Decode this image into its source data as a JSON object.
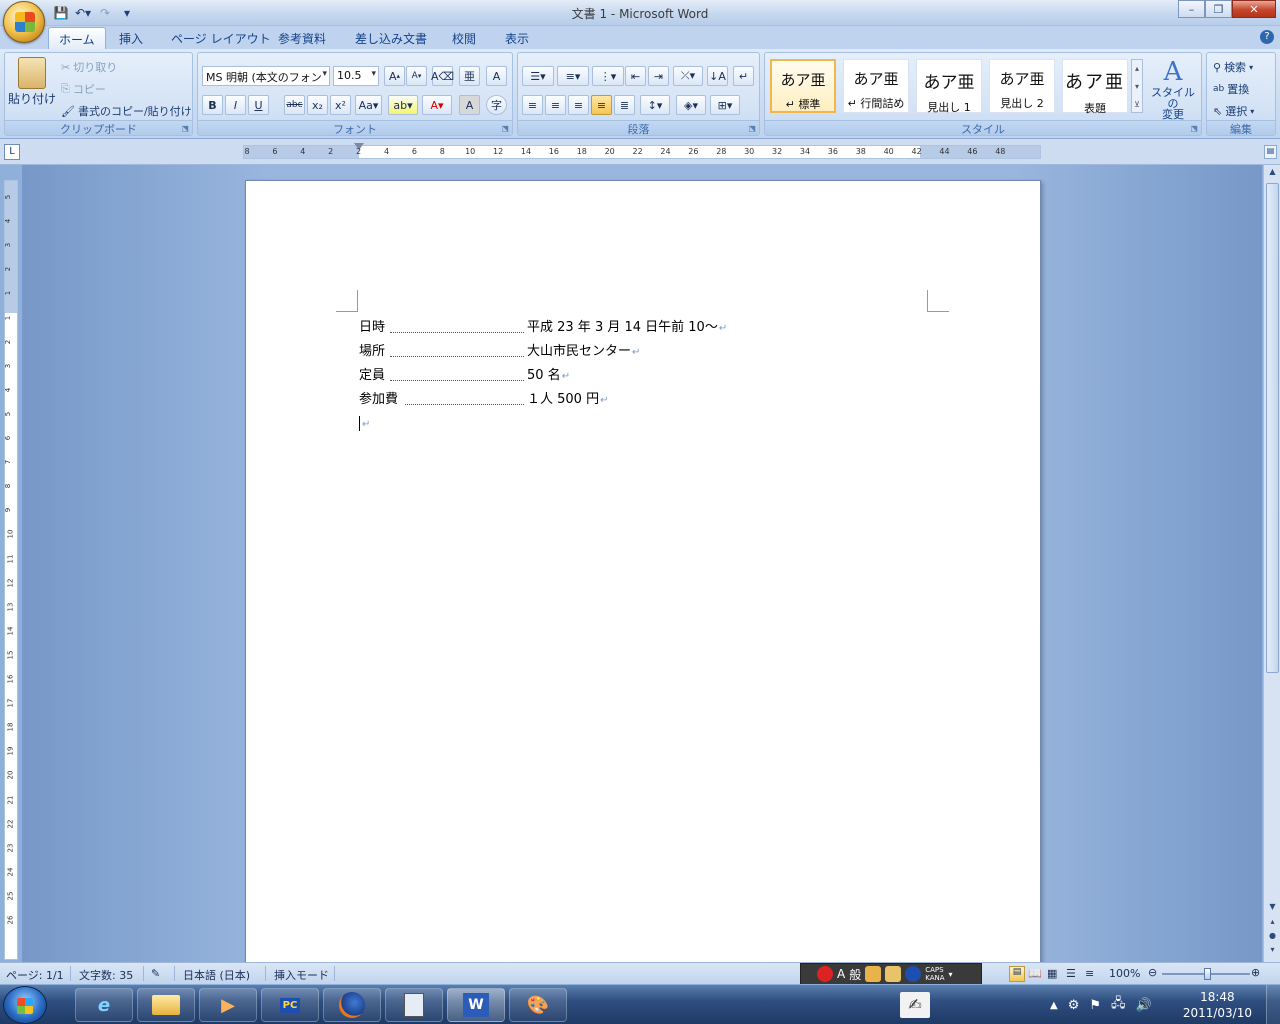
{
  "title": "文書 1 - Microsoft Word",
  "tabs": [
    "ホーム",
    "挿入",
    "ページ レイアウト",
    "参考資料",
    "差し込み文書",
    "校閲",
    "表示"
  ],
  "clipboard": {
    "paste": "貼り付け",
    "cut": "切り取り",
    "copy": "コピー",
    "format_painter": "書式のコピー/貼り付け",
    "group_label": "クリップボード"
  },
  "font": {
    "name": "MS 明朝 (本文のフォン",
    "size": "10.5",
    "group_label": "フォント"
  },
  "paragraph": {
    "group_label": "段落"
  },
  "styles": {
    "items": [
      {
        "sample": "あア亜",
        "name": "↵ 標準"
      },
      {
        "sample": "あア亜",
        "name": "↵ 行間詰め"
      },
      {
        "sample": "あア亜",
        "name": "見出し 1"
      },
      {
        "sample": "あア亜",
        "name": "見出し 2"
      },
      {
        "sample": "あア亜",
        "name": "表題"
      }
    ],
    "change_line1": "スタイルの",
    "change_line2": "変更",
    "group_label": "スタイル"
  },
  "editing": {
    "find": "検索",
    "replace": "置換",
    "select": "選択",
    "group_label": "編集"
  },
  "ruler": {
    "ticks": [
      "8",
      "6",
      "4",
      "2",
      "2",
      "4",
      "6",
      "8",
      "10",
      "12",
      "14",
      "16",
      "18",
      "20",
      "22",
      "24",
      "26",
      "28",
      "30",
      "32",
      "34",
      "36",
      "38",
      "40",
      "42",
      "44",
      "46",
      "48"
    ]
  },
  "vruler": {
    "ticks": [
      "5",
      "4",
      "3",
      "2",
      "1",
      "1",
      "2",
      "3",
      "4",
      "5",
      "6",
      "7",
      "8",
      "9",
      "10",
      "11",
      "12",
      "13",
      "14",
      "15",
      "16",
      "17",
      "18",
      "19",
      "20",
      "21",
      "22",
      "23",
      "24",
      "25",
      "26"
    ]
  },
  "document": {
    "lines": [
      {
        "label": "日時",
        "value": "平成 23 年 3 月 14 日午前 10～"
      },
      {
        "label": "場所",
        "value": "大山市民センター"
      },
      {
        "label": "定員",
        "value": "50 名"
      },
      {
        "label": "参加費",
        "value": "１人 500 円"
      }
    ],
    "para_mark": "↵"
  },
  "status": {
    "page": "ページ: 1/1",
    "words": "文字数: 35",
    "language": "日本語 (日本)",
    "mode": "挿入モード",
    "zoom": "100%"
  },
  "ime": {
    "mode_char": "A",
    "dict": "般",
    "caps": "CAPS",
    "kana": "KANA"
  },
  "taskbar": {
    "time": "18:48",
    "date": "2011/03/10"
  }
}
